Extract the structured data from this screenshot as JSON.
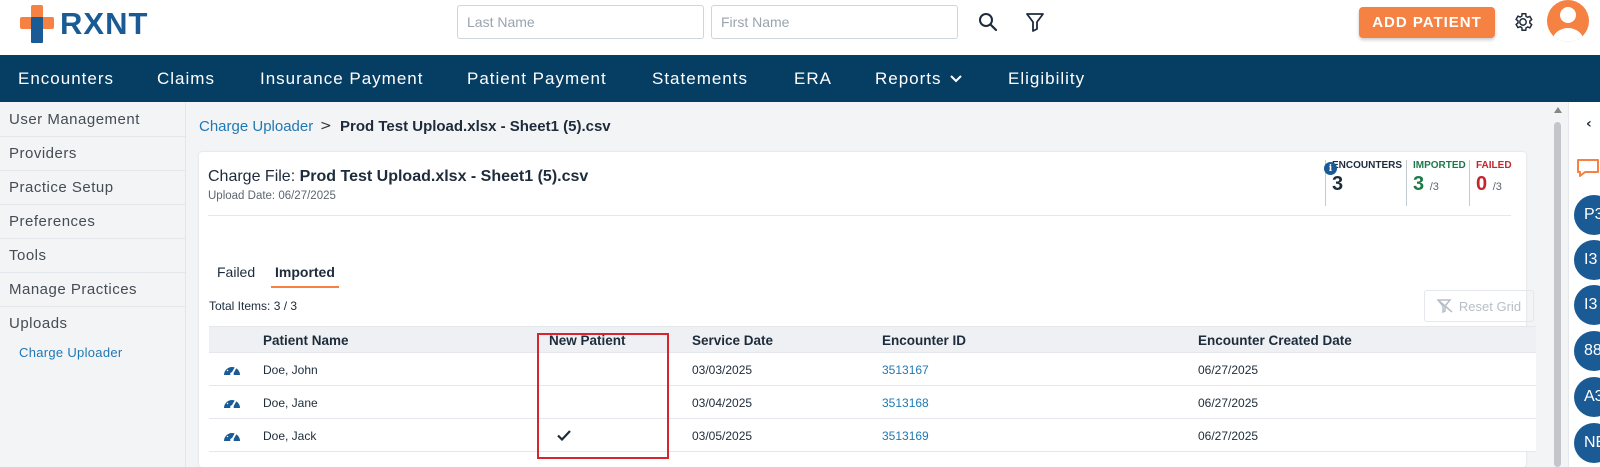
{
  "header": {
    "logo_text": "RXNT",
    "last_name_placeholder": "Last Name",
    "first_name_placeholder": "First Name",
    "add_patient_label": "ADD PATIENT",
    "brand_color": "#1a5b95",
    "accent_color": "#f58242"
  },
  "nav": {
    "items": [
      {
        "label": "Encounters"
      },
      {
        "label": "Claims"
      },
      {
        "label": "Insurance Payment"
      },
      {
        "label": "Patient Payment"
      },
      {
        "label": "Statements"
      },
      {
        "label": "ERA"
      },
      {
        "label": "Reports"
      },
      {
        "label": "Eligibility"
      }
    ]
  },
  "sidebar": {
    "items": [
      {
        "label": "User Management"
      },
      {
        "label": "Providers"
      },
      {
        "label": "Practice Setup"
      },
      {
        "label": "Preferences"
      },
      {
        "label": "Tools"
      },
      {
        "label": "Manage Practices"
      },
      {
        "label": "Uploads"
      }
    ],
    "sub_item": "Charge Uploader"
  },
  "breadcrumb": {
    "parent": "Charge Uploader",
    "separator": ">",
    "current": "Prod Test Upload.xlsx - Sheet1 (5).csv"
  },
  "charge_file": {
    "label": "Charge File:",
    "file_name": "Prod Test Upload.xlsx - Sheet1 (5).csv",
    "upload_date": "Upload Date: 06/27/2025"
  },
  "stats": {
    "encounters": {
      "label": "ENCOUNTERS",
      "value": "3",
      "color": "#1d2b3a"
    },
    "imported": {
      "label": "IMPORTED",
      "value": "3",
      "denominator": "/3",
      "color": "#1c7a4a"
    },
    "failed": {
      "label": "FAILED",
      "value": "0",
      "denominator": "/3",
      "color": "#c4262e"
    }
  },
  "tabs": {
    "failed": "Failed",
    "imported": "Imported",
    "active": "Imported"
  },
  "grid": {
    "total_items": "Total Items: 3 / 3",
    "reset_label": "Reset Grid",
    "columns": {
      "patient_name": "Patient Name",
      "new_patient": "New Patient",
      "service_date": "Service Date",
      "encounter_id": "Encounter ID",
      "encounter_created": "Encounter Created Date"
    },
    "rows": [
      {
        "patient_name": "Doe, John",
        "new_patient": false,
        "service_date": "03/03/2025",
        "encounter_id": "3513167",
        "created_date": "06/27/2025"
      },
      {
        "patient_name": "Doe, Jane",
        "new_patient": false,
        "service_date": "03/04/2025",
        "encounter_id": "3513168",
        "created_date": "06/27/2025"
      },
      {
        "patient_name": "Doe, Jack",
        "new_patient": true,
        "service_date": "03/05/2025",
        "encounter_id": "3513169",
        "created_date": "06/27/2025"
      }
    ]
  },
  "right_rail": {
    "bubbles": [
      "P3",
      "I3",
      "I3",
      "88",
      "A3",
      "NE"
    ]
  }
}
